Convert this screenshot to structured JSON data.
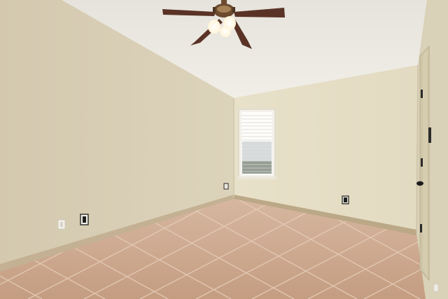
{
  "scene": {
    "subject": "empty-bedroom-interior",
    "colors": {
      "ceiling": "#ece9e2",
      "left_wall": "#d8cfb6",
      "back_wall": "#e6dfc7",
      "right_wall": "#ddd6bd",
      "floor_tile": "#c9a489",
      "grout": "#e2c8b4",
      "baseboard": "#c0ad8e",
      "fan_blade": "#5a3326",
      "fan_body": "#6b4a2f",
      "window_light": "#ffffff",
      "door": "#cfc5a7",
      "hardware": "#2a2a2a"
    },
    "objects": [
      "ceiling-fan-icon",
      "window-with-blinds",
      "door-with-black-hinges",
      "electrical-outlet",
      "light-switch",
      "tile-floor",
      "vaulted-ceiling"
    ]
  }
}
